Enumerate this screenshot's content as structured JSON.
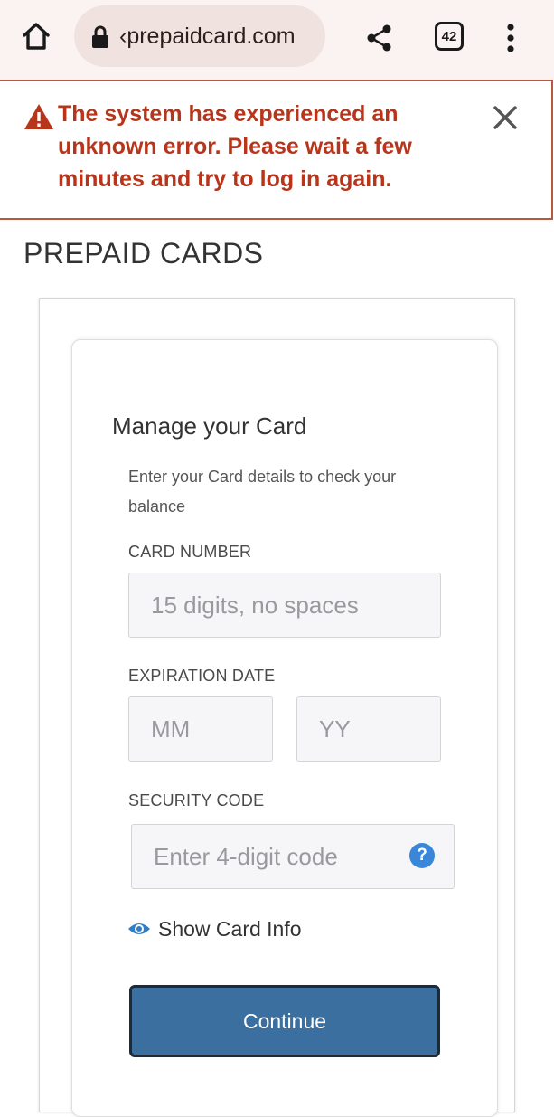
{
  "browser": {
    "url": "‹prepaidcard.com",
    "tab_count": "42",
    "icons": {
      "home": "home-icon",
      "lock": "lock-icon",
      "share": "share-icon",
      "menu": "more-vert-icon"
    }
  },
  "error_banner": {
    "message": "The system has experienced an unknown error. Please wait a few minutes and try to log in again.",
    "icon": "warning-icon",
    "close_icon": "close-icon",
    "text_color": "#b6351b",
    "border_color": "#b55a3c"
  },
  "page": {
    "title": "PREPAID CARDS"
  },
  "form": {
    "title": "Manage your Card",
    "subtitle": "Enter your Card details to check your balance",
    "card_number": {
      "label": "CARD NUMBER",
      "placeholder": "15 digits, no spaces",
      "value": ""
    },
    "expiration": {
      "label": "EXPIRATION DATE",
      "month_placeholder": "MM",
      "year_placeholder": "YY"
    },
    "security_code": {
      "label": "SECURITY CODE",
      "placeholder": "Enter 4-digit code",
      "help_icon": "help-circle-icon",
      "help_glyph": "?"
    },
    "show_card_info": {
      "label": "Show Card Info",
      "icon": "eye-icon"
    },
    "continue_label": "Continue",
    "accent_color": "#3b6fa0"
  }
}
